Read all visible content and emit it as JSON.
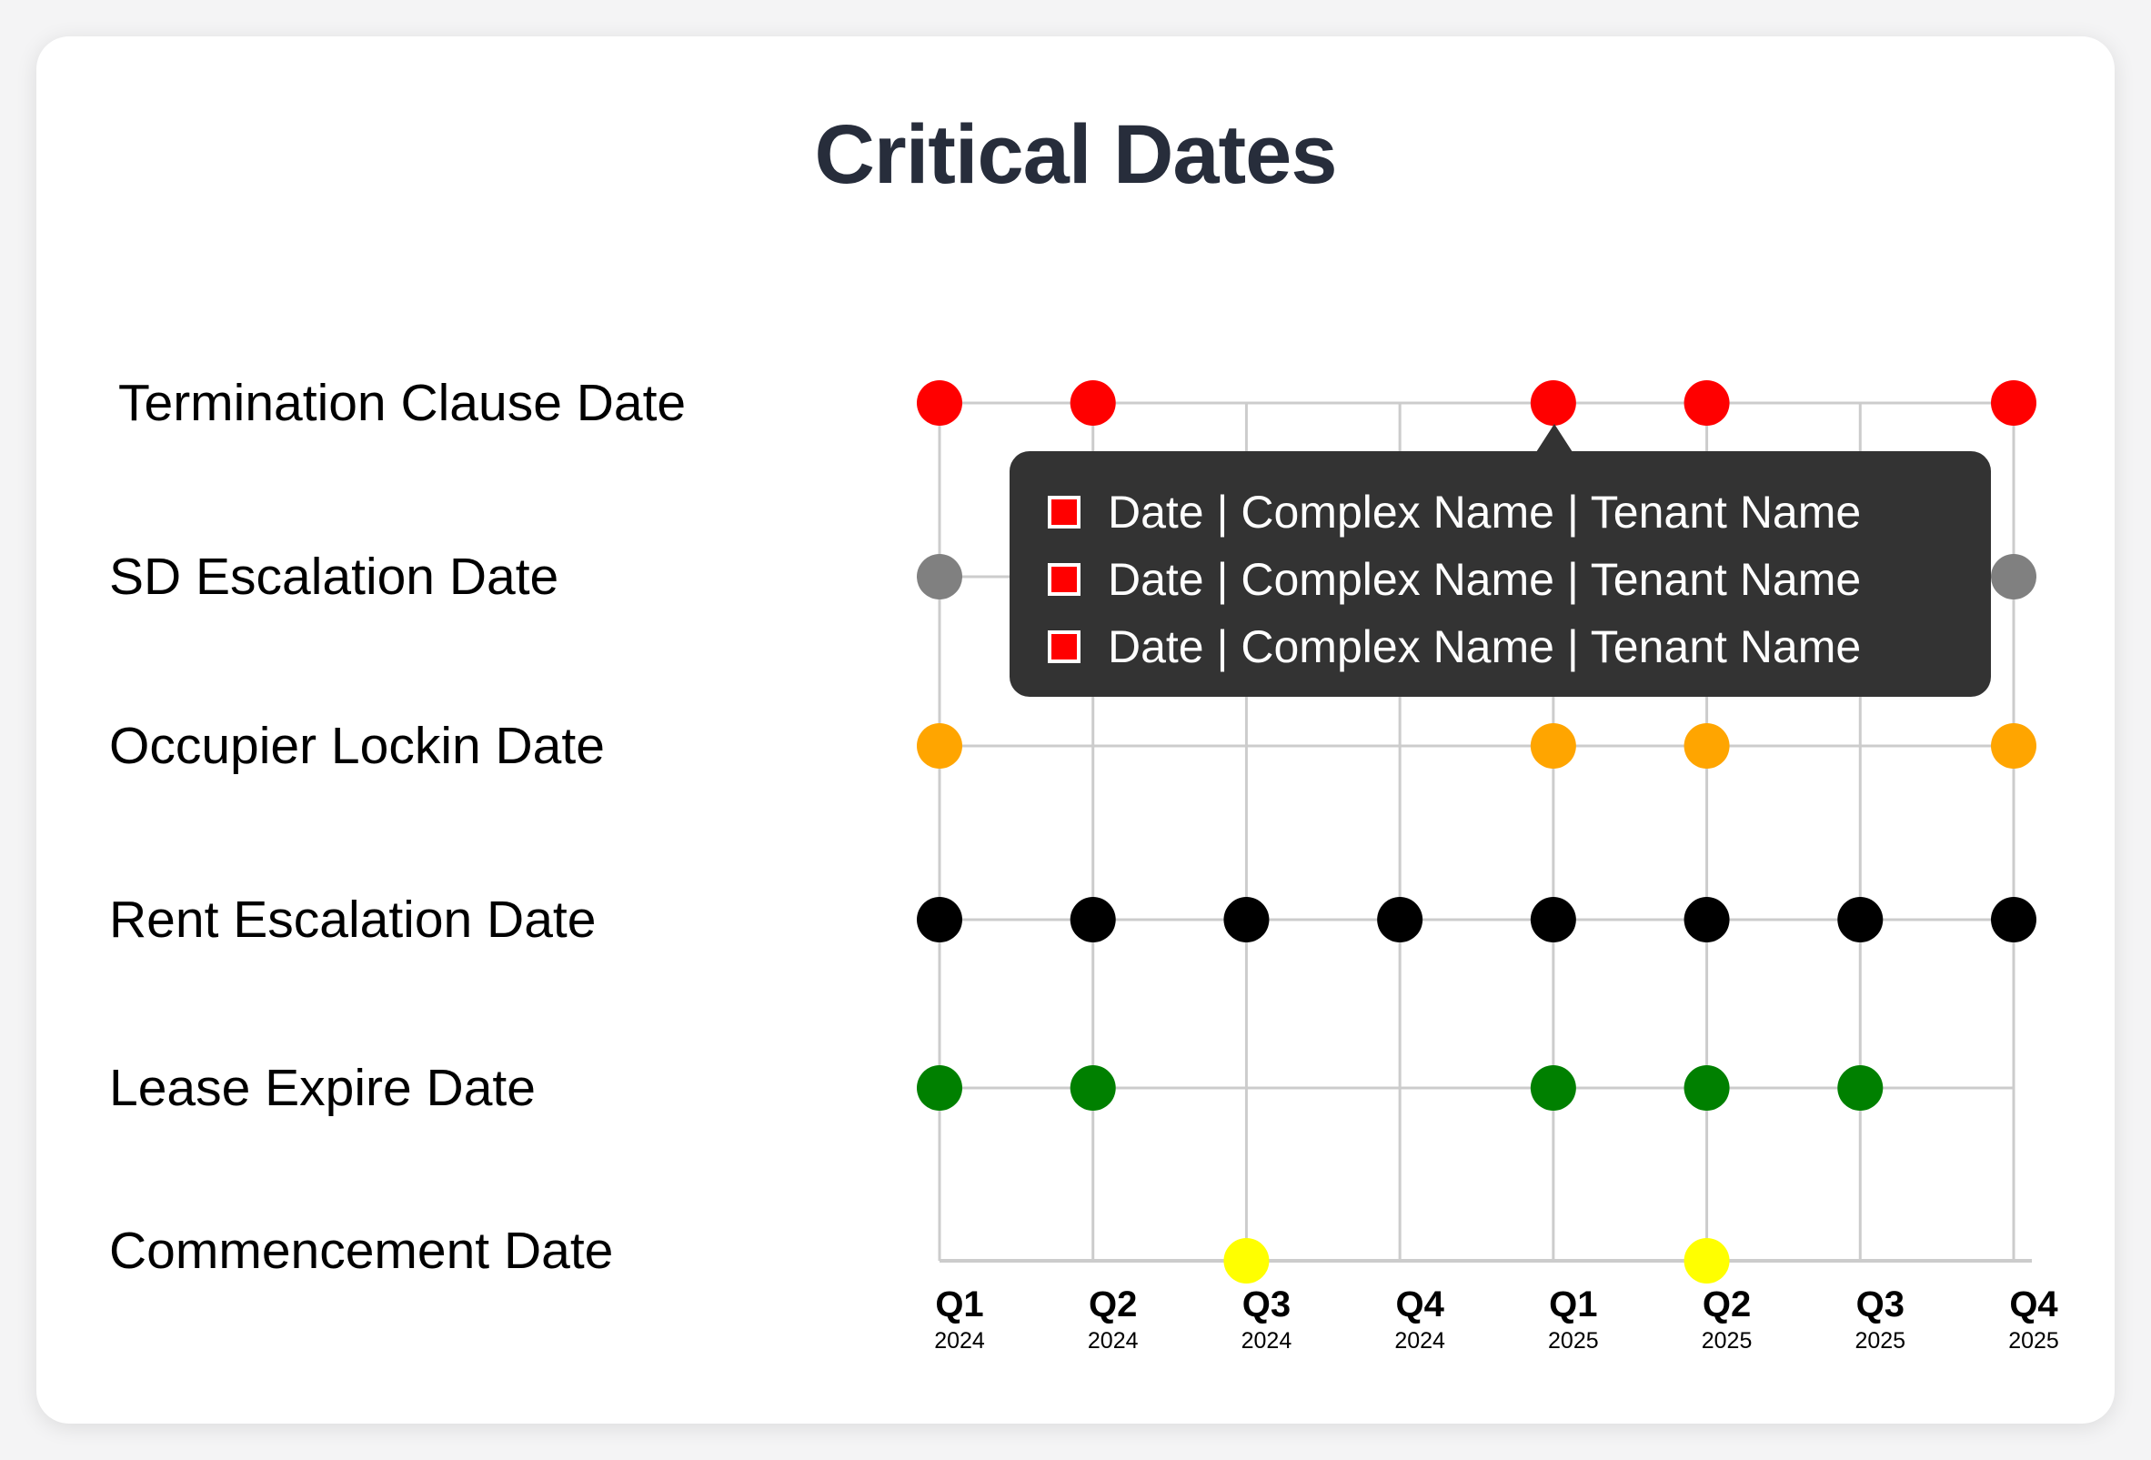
{
  "chart_data": {
    "type": "scatter",
    "title": "Critical Dates",
    "xlabel": "",
    "ylabel": "",
    "grid": true,
    "x": [
      {
        "quarter": "Q1",
        "year": "2024"
      },
      {
        "quarter": "Q2",
        "year": "2024"
      },
      {
        "quarter": "Q3",
        "year": "2024"
      },
      {
        "quarter": "Q4",
        "year": "2024"
      },
      {
        "quarter": "Q1",
        "year": "2025"
      },
      {
        "quarter": "Q2",
        "year": "2025"
      },
      {
        "quarter": "Q3",
        "year": "2025"
      },
      {
        "quarter": "Q4",
        "year": "2025"
      }
    ],
    "series": [
      {
        "name": "Termination Clause Date",
        "color": "#ff0000",
        "points": [
          0,
          1,
          4,
          5,
          7
        ]
      },
      {
        "name": "SD Escalation Date",
        "color": "#808080",
        "points": [
          0,
          7
        ]
      },
      {
        "name": "Occupier Lockin Date",
        "color": "#ffa500",
        "points": [
          0,
          4,
          5,
          7
        ]
      },
      {
        "name": "Rent Escalation Date",
        "color": "#000000",
        "points": [
          0,
          1,
          2,
          3,
          4,
          5,
          6,
          7
        ]
      },
      {
        "name": "Lease Expire Date",
        "color": "#008000",
        "points": [
          0,
          1,
          4,
          5,
          6
        ]
      },
      {
        "name": "Commencement Date",
        "color": "#ffff00",
        "points": [
          2,
          5
        ]
      }
    ],
    "tooltip": {
      "series": "Termination Clause Date",
      "point_index": 4,
      "swatch_color": "#ff0000",
      "lines": [
        "Date | Complex Name | Tenant Name",
        "Date | Complex Name | Tenant Name",
        "Date | Complex Name | Tenant Name"
      ]
    }
  },
  "colors": {
    "title": "#272d3b",
    "grid": "#cccccc",
    "tooltip_bg": "#333333"
  }
}
